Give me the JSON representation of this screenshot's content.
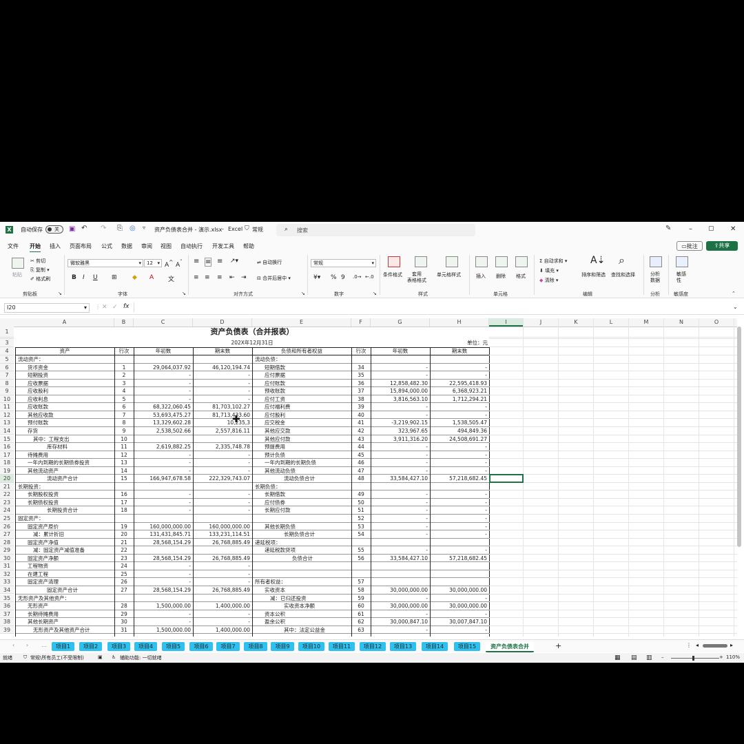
{
  "titlebar": {
    "autosave": "自动保存",
    "autosave_state": "关",
    "filename": "资产负债表合并 - 演示.xlsx",
    "app": "Excel",
    "sensitivity": "常规",
    "search_placeholder": "搜索"
  },
  "menu": [
    "文件",
    "开始",
    "插入",
    "页面布局",
    "公式",
    "数据",
    "审阅",
    "视图",
    "自动执行",
    "开发工具",
    "帮助"
  ],
  "actions": {
    "comment": "批注",
    "share": "共享"
  },
  "ribbon": {
    "clipboard": {
      "paste": "粘贴",
      "cut": "剪切",
      "copy": "复制",
      "format_painter": "格式刷",
      "label": "剪贴板"
    },
    "font": {
      "name": "微软雅黑",
      "size": "12",
      "label": "字体"
    },
    "align": {
      "wrap": "自动换行",
      "merge": "合并后居中",
      "label": "对齐方式"
    },
    "number": {
      "format": "常规",
      "label": "数字"
    },
    "styles": {
      "cond": "条件格式",
      "table": "套用\n表格格式",
      "cell": "单元格样式",
      "label": "样式"
    },
    "cells": {
      "insert": "插入",
      "delete": "删除",
      "format": "格式",
      "label": "单元格"
    },
    "edit": {
      "autosum": "自动求和",
      "fill": "填充",
      "clear": "清除",
      "sort": "排序和筛选",
      "find": "查找和选择",
      "label": "编辑"
    },
    "analysis": {
      "btn": "分析\n数据",
      "label": "分析"
    },
    "sensitivity": {
      "btn": "敏感\n性",
      "label": "敏感度"
    }
  },
  "formula": {
    "namebox": "I20",
    "fx": "fx"
  },
  "columns": [
    "A",
    "B",
    "C",
    "D",
    "E",
    "F",
    "G",
    "H",
    "I",
    "J",
    "K",
    "L",
    "M",
    "N",
    "O"
  ],
  "sheet": {
    "title": "资产负债表（合并报表）",
    "date": "202X年12月31日",
    "unit": "单位：元",
    "headers": [
      "资产",
      "行次",
      "年初数",
      "期末数",
      "负债和所有者权益",
      "行次",
      "年初数",
      "期末数"
    ],
    "rows": [
      {
        "r": "5",
        "a": "流动资产：",
        "ai": 0,
        "b": "",
        "c": "",
        "d": "",
        "e": "流动负债：",
        "ei": 0,
        "f": "",
        "g": "",
        "h": ""
      },
      {
        "r": "6",
        "a": "货币资金",
        "ai": 1,
        "b": "1",
        "c": "29,064,037.92",
        "d": "46,120,194.74",
        "e": "短期借款",
        "ei": 1,
        "f": "34",
        "g": "-",
        "h": "-"
      },
      {
        "r": "7",
        "a": "短期投资",
        "ai": 1,
        "b": "2",
        "c": "-",
        "d": "-",
        "e": "应付票据",
        "ei": 1,
        "f": "35",
        "g": "-",
        "h": "-"
      },
      {
        "r": "8",
        "a": "应收票据",
        "ai": 1,
        "b": "3",
        "c": "-",
        "d": "-",
        "e": "应付账款",
        "ei": 1,
        "f": "36",
        "g": "12,858,482.30",
        "h": "22,595,418.93"
      },
      {
        "r": "9",
        "a": "应收股利",
        "ai": 1,
        "b": "4",
        "c": "-",
        "d": "-",
        "e": "预收账款",
        "ei": 1,
        "f": "37",
        "g": "15,894,000.00",
        "h": "6,368,923.21"
      },
      {
        "r": "10",
        "a": "应收利息",
        "ai": 1,
        "b": "5",
        "c": "-",
        "d": "-",
        "e": "应付工资",
        "ei": 1,
        "f": "38",
        "g": "3,816,563.10",
        "h": "1,712,294.21"
      },
      {
        "r": "11",
        "a": "应收账款",
        "ai": 1,
        "b": "6",
        "c": "68,322,060.45",
        "d": "81,703,102.27",
        "e": "应付福利费",
        "ei": 1,
        "f": "39",
        "g": "-",
        "h": "-"
      },
      {
        "r": "12",
        "a": "其他应收款",
        "ai": 1,
        "b": "7",
        "c": "53,693,475.27",
        "d": "81,713,433.60",
        "e": "应付股利",
        "ei": 1,
        "f": "40",
        "g": "-",
        "h": "-"
      },
      {
        "r": "13",
        "a": "预付账款",
        "ai": 1,
        "b": "8",
        "c": "13,329,602.28",
        "d": "10,235,3",
        "e": "应交税金",
        "ei": 1,
        "f": "41",
        "g": "-3,219,902.15",
        "h": "1,538,505.47"
      },
      {
        "r": "14",
        "a": "存货",
        "ai": 1,
        "b": "9",
        "c": "2,538,502.66",
        "d": "2,557,816.11",
        "e": "其他应交款",
        "ei": 1,
        "f": "42",
        "g": "323,967.65",
        "h": "494,849.36"
      },
      {
        "r": "15",
        "a": "其中：工程支出",
        "ai": 2,
        "b": "10",
        "c": "",
        "d": "",
        "e": "其他应付款",
        "ei": 1,
        "f": "43",
        "g": "3,911,316.20",
        "h": "24,508,691.27"
      },
      {
        "r": "16",
        "a": "库存材料",
        "ai": 4,
        "b": "11",
        "c": "2,619,882.25",
        "d": "2,335,748.78",
        "e": "预提费用",
        "ei": 1,
        "f": "44",
        "g": "-",
        "h": "-"
      },
      {
        "r": "17",
        "a": "待摊费用",
        "ai": 1,
        "b": "12",
        "c": "-",
        "d": "-",
        "e": "预计负债",
        "ei": 1,
        "f": "45",
        "g": "-",
        "h": "-"
      },
      {
        "r": "18",
        "a": "一年内到期的长期债券投资",
        "ai": 1,
        "b": "13",
        "c": "-",
        "d": "-",
        "e": "一年内到期的长期负债",
        "ei": 1,
        "f": "46",
        "g": "-",
        "h": "-"
      },
      {
        "r": "19",
        "a": "其他流动资产",
        "ai": 1,
        "b": "14",
        "c": "-",
        "d": "-",
        "e": "其他流动负债",
        "ei": 1,
        "f": "47",
        "g": "-",
        "h": "-"
      },
      {
        "r": "20",
        "a": "流动资产合计",
        "ai": 4,
        "b": "15",
        "c": "166,947,678.58",
        "d": "222,329,743.07",
        "e": "流动负债合计",
        "ei": 4,
        "f": "48",
        "g": "33,584,427.10",
        "h": "57,218,682.45"
      },
      {
        "r": "21",
        "a": "长期投资：",
        "ai": 0,
        "b": "",
        "c": "",
        "d": "",
        "e": "长期负债：",
        "ei": 0,
        "f": "",
        "g": "",
        "h": ""
      },
      {
        "r": "22",
        "a": "长期股权投资",
        "ai": 1,
        "b": "16",
        "c": "-",
        "d": "-",
        "e": "长期借款",
        "ei": 1,
        "f": "49",
        "g": "-",
        "h": "-"
      },
      {
        "r": "23",
        "a": "长期债权投资",
        "ai": 1,
        "b": "17",
        "c": "-",
        "d": "-",
        "e": "应付债券",
        "ei": 1,
        "f": "50",
        "g": "-",
        "h": "-"
      },
      {
        "r": "24",
        "a": "长期投资合计",
        "ai": 4,
        "b": "18",
        "c": "-",
        "d": "-",
        "e": "长期应付款",
        "ei": 1,
        "f": "51",
        "g": "-",
        "h": "-"
      },
      {
        "r": "25",
        "a": "固定资产：",
        "ai": 0,
        "b": "",
        "c": "",
        "d": "",
        "e": "",
        "ei": 1,
        "f": "52",
        "g": "-",
        "h": "-"
      },
      {
        "r": "26",
        "a": "固定资产原价",
        "ai": 1,
        "b": "19",
        "c": "160,000,000.00",
        "d": "160,000,000.00",
        "e": "其他长期负债",
        "ei": 1,
        "f": "53",
        "g": "-",
        "h": "-"
      },
      {
        "r": "27",
        "a": "减：累计折旧",
        "ai": 2,
        "b": "20",
        "c": "131,431,845.71",
        "d": "133,231,114.51",
        "e": "长期负债合计",
        "ei": 4,
        "f": "54",
        "g": "-",
        "h": "-"
      },
      {
        "r": "28",
        "a": "固定资产净值",
        "ai": 1,
        "b": "21",
        "c": "28,568,154.29",
        "d": "26,768,885.49",
        "e": "递延税项：",
        "ei": 0,
        "f": "",
        "g": "",
        "h": ""
      },
      {
        "r": "29",
        "a": "减：固定资产减值准备",
        "ai": 2,
        "b": "22",
        "c": "",
        "d": "",
        "e": "递延税款贷项",
        "ei": 1,
        "f": "55",
        "g": "-",
        "h": "-"
      },
      {
        "r": "30",
        "a": "固定资产净额",
        "ai": 1,
        "b": "23",
        "c": "28,568,154.29",
        "d": "26,768,885.49",
        "e": "负债合计",
        "ei": 5,
        "f": "56",
        "g": "33,584,427.10",
        "h": "57,218,682.45"
      },
      {
        "r": "31",
        "a": "工程物资",
        "ai": 1,
        "b": "24",
        "c": "-",
        "d": "-",
        "e": "",
        "ei": 1,
        "f": "",
        "g": "",
        "h": ""
      },
      {
        "r": "32",
        "a": "在建工程",
        "ai": 1,
        "b": "25",
        "c": "-",
        "d": "-",
        "e": "",
        "ei": 1,
        "f": "",
        "g": "",
        "h": ""
      },
      {
        "r": "33",
        "a": "固定资产清理",
        "ai": 1,
        "b": "26",
        "c": "-",
        "d": "-",
        "e": "所有者权益：",
        "ei": 0,
        "f": "57",
        "g": "",
        "h": ""
      },
      {
        "r": "34",
        "a": "固定资产合计",
        "ai": 4,
        "b": "27",
        "c": "28,568,154.29",
        "d": "26,768,885.49",
        "e": "实收资本",
        "ei": 1,
        "f": "58",
        "g": "30,000,000.00",
        "h": "30,000,000.00"
      },
      {
        "r": "35",
        "a": "无形资产及其他资产：",
        "ai": 0,
        "b": "",
        "c": "",
        "d": "",
        "e": "减：已归还投资",
        "ei": 2,
        "f": "59",
        "g": "-",
        "h": "-"
      },
      {
        "r": "36",
        "a": "无形资产",
        "ai": 1,
        "b": "28",
        "c": "1,500,000.00",
        "d": "1,400,000.00",
        "e": "实收资本净额",
        "ei": 4,
        "f": "60",
        "g": "30,000,000.00",
        "h": "30,000,000.00"
      },
      {
        "r": "37",
        "a": "长期待摊费用",
        "ai": 1,
        "b": "29",
        "c": "-",
        "d": "-",
        "e": "资本公积",
        "ei": 1,
        "f": "61",
        "g": "-",
        "h": "-"
      },
      {
        "r": "38",
        "a": "其他长期资产",
        "ai": 1,
        "b": "30",
        "c": "-",
        "d": "-",
        "e": "盈余公积",
        "ei": 1,
        "f": "62",
        "g": "30,000,847.10",
        "h": "30,007,847.10"
      },
      {
        "r": "39",
        "a": "无形资产及其他资产合计",
        "ai": 2,
        "b": "31",
        "c": "1,500,000.00",
        "d": "1,400,000.00",
        "e": "其中：法定公益金",
        "ei": 4,
        "f": "63",
        "g": "-",
        "h": "-"
      }
    ]
  },
  "tabs": [
    "项目1",
    "项目2",
    "项目3",
    "项目4",
    "项目5",
    "项目6",
    "项目7",
    "项目8",
    "项目9",
    "项目10",
    "项目11",
    "项目12",
    "项目13",
    "项目14",
    "项目15",
    "资产负债表合并"
  ],
  "status": {
    "ready": "就绪",
    "note": "常规\\所有员工(不受限制)",
    "access": "辅助功能: 一切就绪",
    "zoom": "110%"
  }
}
